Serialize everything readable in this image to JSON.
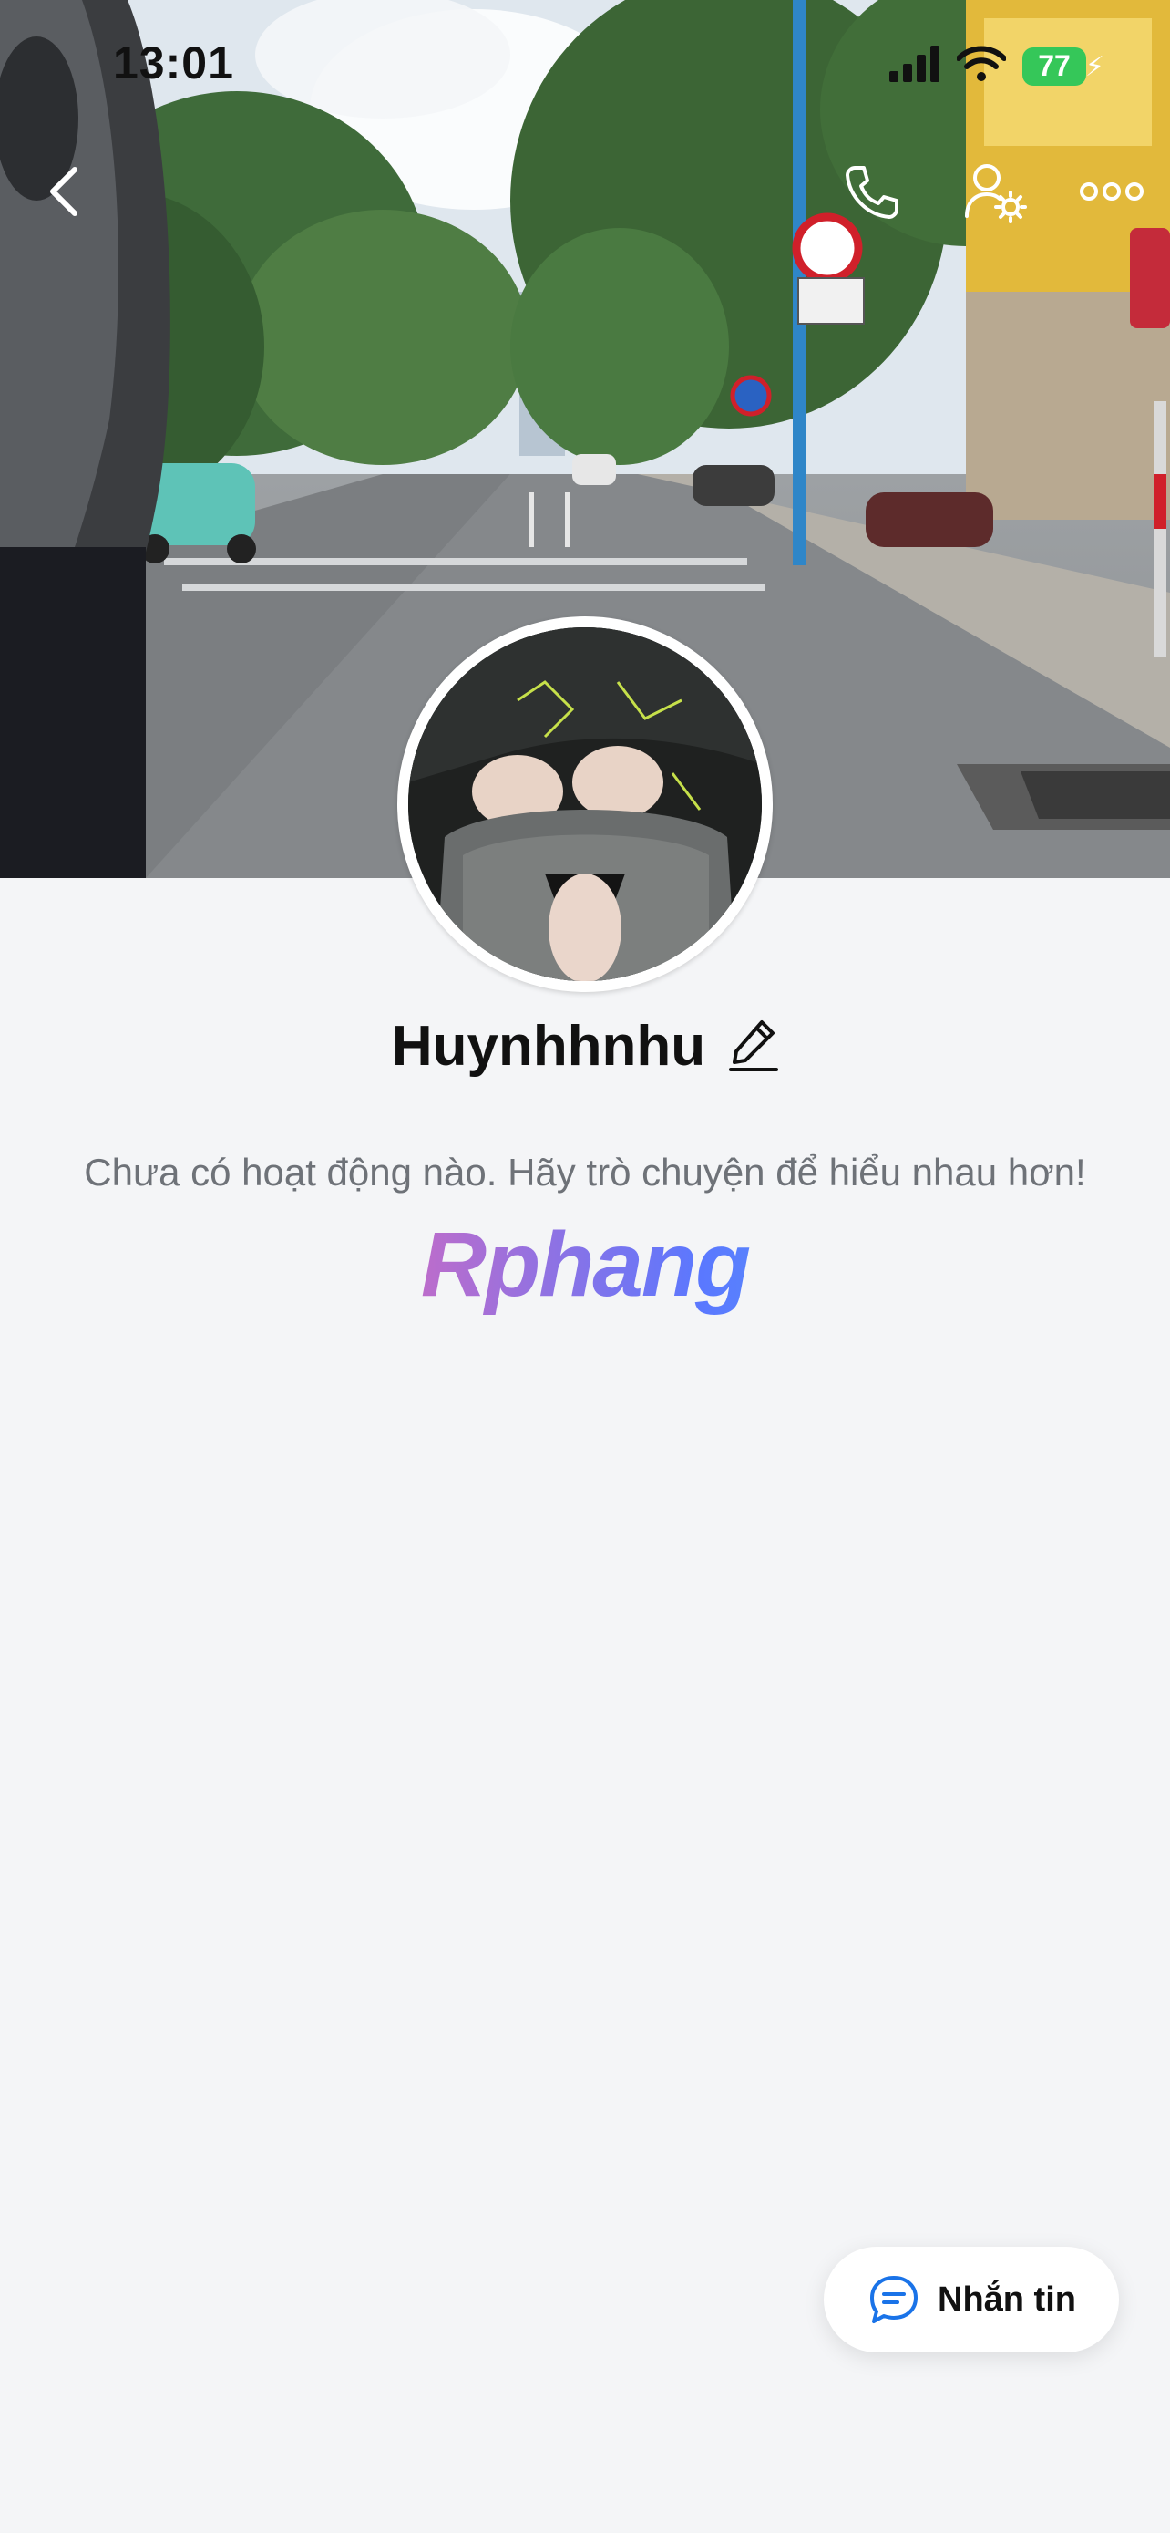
{
  "status_bar": {
    "time": "13:01",
    "battery": "77",
    "icons": [
      "cellular-signal-icon",
      "wifi-icon",
      "battery-icon"
    ]
  },
  "nav": {
    "icons": [
      "back-icon",
      "phone-icon",
      "user-settings-icon",
      "more-icon"
    ]
  },
  "profile": {
    "name": "Huynhhnhu",
    "activity_text": "Chưa có hoạt động nào. Hãy trò chuyện để hiểu nhau hơn!",
    "watermark": "Rphang"
  },
  "actions": {
    "message_label": "Nhắn tin"
  },
  "colors": {
    "background": "#f4f5f7",
    "battery_green": "#35c759",
    "message_icon_blue": "#1a73e8"
  }
}
